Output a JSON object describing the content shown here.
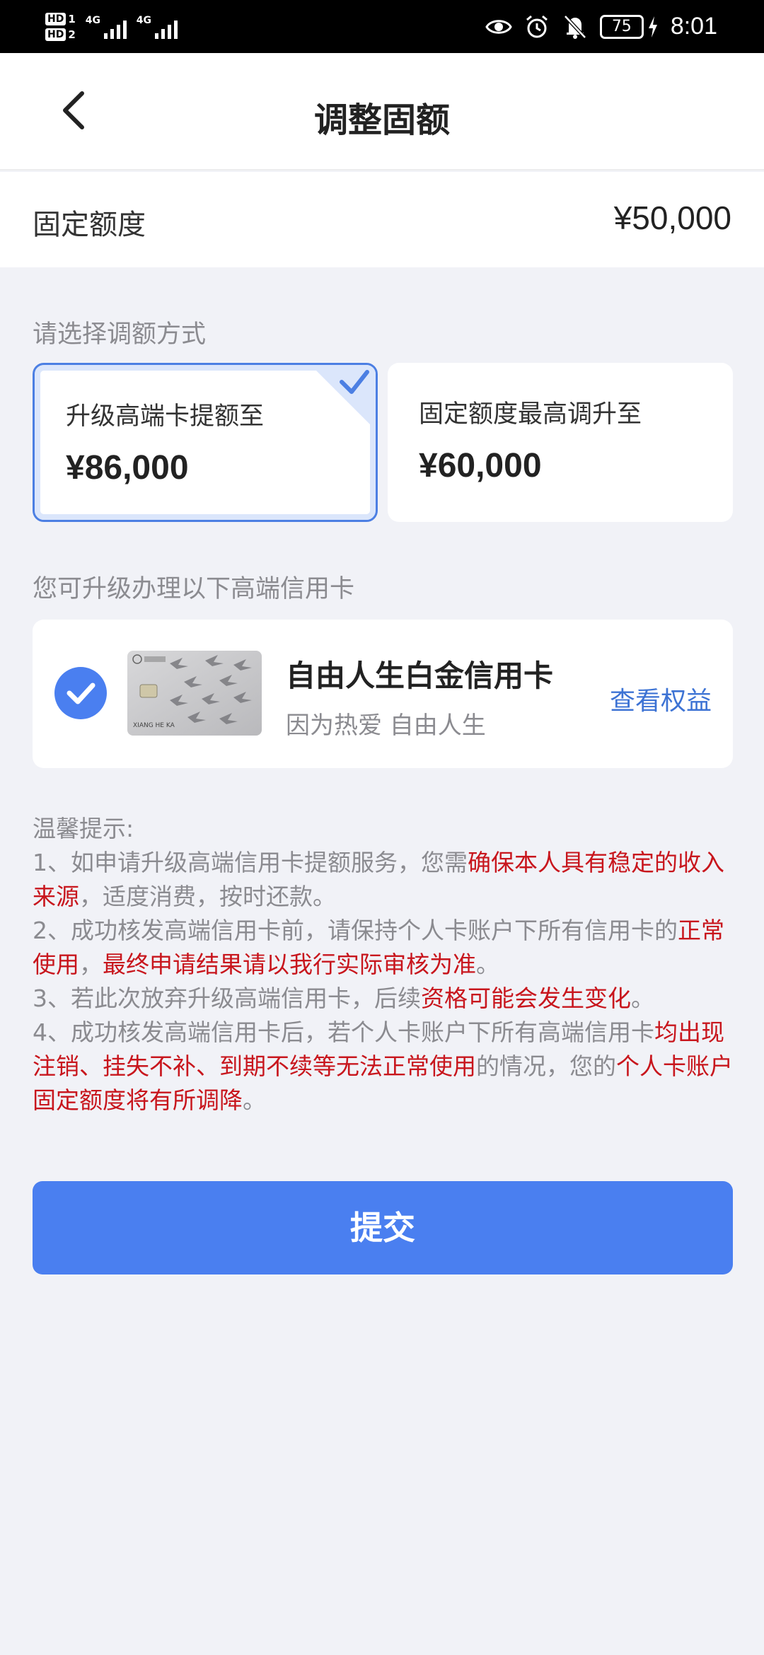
{
  "status_bar": {
    "sim1": "HD",
    "sim1_index": "1",
    "sim2": "HD",
    "sim2_index": "2",
    "network1": "4G",
    "network2": "4G",
    "battery": "75",
    "time": "8:01",
    "icons": [
      "eye-icon",
      "alarm-icon",
      "bell-off-icon",
      "charging-icon"
    ]
  },
  "header": {
    "title": "调整固额",
    "back_icon": "chevron-left-icon"
  },
  "fixed_limit": {
    "label": "固定额度",
    "value": "¥50,000"
  },
  "adjust_section_label": "请选择调额方式",
  "options": [
    {
      "label": "升级高端卡提额至",
      "value": "¥86,000",
      "selected": true
    },
    {
      "label": "固定额度最高调升至",
      "value": "¥60,000",
      "selected": false
    }
  ],
  "upgrade_section_label": "您可升级办理以下高端信用卡",
  "card": {
    "name": "自由人生白金信用卡",
    "slogan": "因为热爱 自由人生",
    "benefits_link": "查看权益",
    "image_text": "XIANG HE KA",
    "selected": true
  },
  "tips": {
    "title": "温馨提示:",
    "line1_pre": "1、如申请升级高端信用卡提额服务，您需",
    "line1_hl": "确保本人具有稳定的收入来源",
    "line1_post": "，适度消费，按时还款。",
    "line2_pre": "2、成功核发高端信用卡前，请保持个人卡账户下所有信用卡的",
    "line2_hl1": "正常使用",
    "line2_mid": "，",
    "line2_hl2": "最终申请结果请以我行实际审核为准",
    "line2_post": "。",
    "line3_pre": "3、若此次放弃升级高端信用卡，后续",
    "line3_hl": "资格可能会发生变化",
    "line3_post": "。",
    "line4_pre": "4、成功核发高端信用卡后，若个人卡账户下所有高端信用卡",
    "line4_hl1": "均出现注销、挂失不补、到期不续等无法正常使用",
    "line4_mid": "的情况，您的",
    "line4_hl2": "个人卡账户固定额度将有所调降",
    "line4_post": "。"
  },
  "submit_label": "提交",
  "colors": {
    "primary": "#4a7ff0",
    "link": "#3d73d4",
    "highlight": "#c8161d",
    "background": "#f1f2f7"
  }
}
